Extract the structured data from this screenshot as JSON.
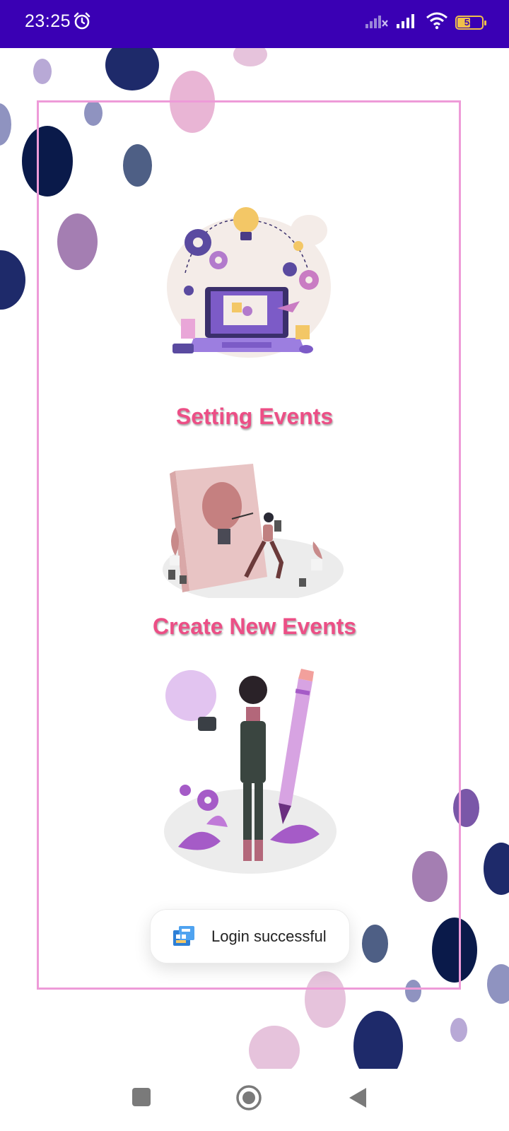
{
  "status_bar": {
    "time": "23:25",
    "battery_level": "53",
    "battery_fraction": 0.53,
    "background_color": "#3a00b4",
    "icons": [
      "alarm-icon",
      "signal-off-icon",
      "signal-icon",
      "wifi-icon",
      "battery-icon"
    ]
  },
  "menu": {
    "items": [
      {
        "label": "Setting Events",
        "illustration": "laptop-gears-lightbulb-illustration"
      },
      {
        "label": "Create New Events",
        "illustration": "woman-painting-lightbulb-illustration"
      },
      {
        "label": "",
        "illustration": "woman-with-giant-pencil-illustration"
      }
    ],
    "label_color": "#ec4f86"
  },
  "toast": {
    "message": "Login successful",
    "icon": "app-icon"
  },
  "decor": {
    "frame_color": "#ee9bd8",
    "dot_colors": [
      "#1a2a6c",
      "#0a1a4a",
      "#4a5a80",
      "#8f93c0",
      "#b8a9d6",
      "#e6b6da",
      "#a47eb2",
      "#7a57a8"
    ]
  },
  "nav_bar": {
    "buttons": [
      "recents-button",
      "home-button",
      "back-button"
    ]
  }
}
